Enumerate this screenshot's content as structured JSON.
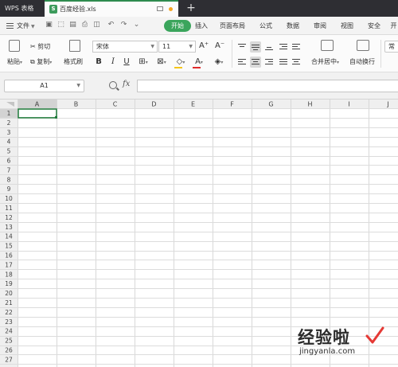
{
  "titlebar": {
    "app_name": "WPS 表格",
    "file_name": "百度经验.xls",
    "new_tab_label": "+"
  },
  "menubar": {
    "file_menu": "文件",
    "tabs": [
      {
        "label": "开始",
        "active": true
      },
      {
        "label": "插入"
      },
      {
        "label": "页面布局"
      },
      {
        "label": "公式"
      },
      {
        "label": "数据"
      },
      {
        "label": "审阅"
      },
      {
        "label": "视图"
      },
      {
        "label": "安全"
      },
      {
        "label": "开"
      }
    ]
  },
  "ribbon": {
    "paste": "粘贴",
    "cut": "剪切",
    "copy": "复制",
    "format_painter": "格式刷",
    "font_name": "宋体",
    "font_size": "11",
    "bold": "B",
    "italic": "I",
    "underline": "U",
    "font_color_letter": "A",
    "grow_font": "A⁺",
    "shrink_font": "A⁻",
    "merge_center": "合并居中",
    "wrap_text": "自动换行",
    "number_format": "常规",
    "accent_color": "#3ba55c",
    "font_color_bar": "#e02b2b",
    "fill_color_bar": "#f5c518"
  },
  "formula_bar": {
    "cell_reference": "A1",
    "fx_label": "fx",
    "formula_value": ""
  },
  "sheet": {
    "columns": [
      "A",
      "B",
      "C",
      "D",
      "E",
      "F",
      "G",
      "H",
      "I",
      "J"
    ],
    "rows": [
      "1",
      "2",
      "3",
      "4",
      "5",
      "6",
      "7",
      "8",
      "9",
      "10",
      "11",
      "12",
      "13",
      "14",
      "15",
      "16",
      "17",
      "18",
      "19",
      "20",
      "21",
      "22",
      "23",
      "24",
      "25",
      "26",
      "27"
    ],
    "selected_cell": "A1"
  },
  "watermark": {
    "text": "经验啦",
    "url": "jingyanla.com",
    "check_color": "#e53935"
  }
}
